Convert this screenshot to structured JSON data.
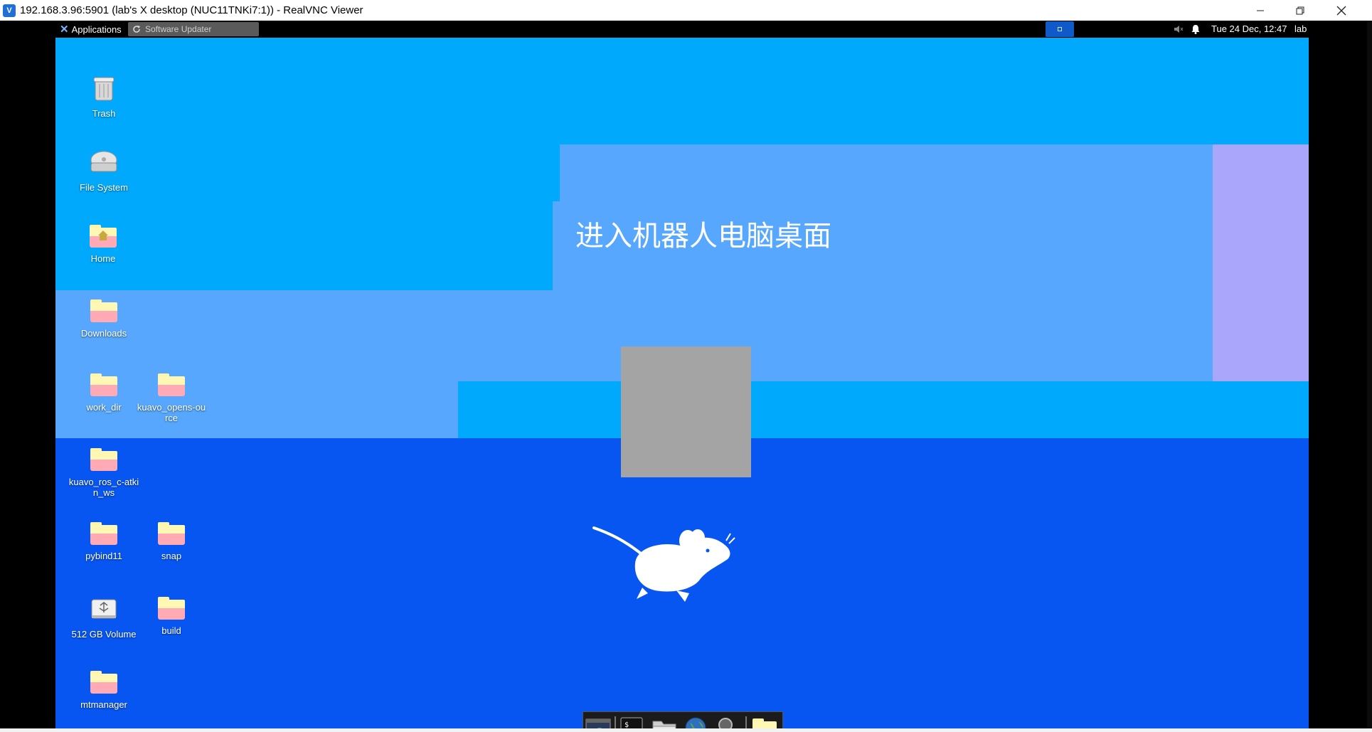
{
  "window": {
    "title": "192.168.3.96:5901 (lab's X desktop (NUC11TNKi7:1)) - RealVNC Viewer",
    "app_icon": "realvnc-logo",
    "controls": [
      "minimize-icon",
      "restore-icon",
      "close-icon"
    ]
  },
  "panel": {
    "applications_label": "Applications",
    "task_label": "Software Updater",
    "clock": "Tue 24 Dec, 12:47",
    "user": "lab",
    "icons": [
      "xfce-icon",
      "refresh-icon",
      "workspace-icon",
      "sound-muted-icon",
      "bell-icon"
    ]
  },
  "desktop": {
    "headline": "进入机器人电脑桌面",
    "colors": {
      "base": "#0856f1",
      "cyan": "#00a9fc",
      "light_blue": "#56a7fd",
      "lavender": "#aaa6fb",
      "grey_box": "#a4a4a4"
    },
    "icons": [
      {
        "label": "Trash",
        "kind": "trash"
      },
      {
        "label": "File System",
        "kind": "drive"
      },
      {
        "label": "Home",
        "kind": "home-folder"
      },
      {
        "label": "Downloads",
        "kind": "folder"
      },
      {
        "label": "work_dir",
        "kind": "folder"
      },
      {
        "label": "kuavo_opens-ource",
        "kind": "folder"
      },
      {
        "label": "kuavo_ros_c-atkin_ws",
        "kind": "folder"
      },
      {
        "label": "pybind11",
        "kind": "folder"
      },
      {
        "label": "snap",
        "kind": "folder"
      },
      {
        "label": "512 GB Volume",
        "kind": "usb-drive"
      },
      {
        "label": "build",
        "kind": "folder"
      },
      {
        "label": "mtmanager",
        "kind": "folder"
      }
    ]
  },
  "dock": {
    "items": [
      "show-desktop-icon",
      "terminal-icon",
      "file-manager-icon",
      "web-browser-icon",
      "search-icon",
      "folder-icon"
    ]
  }
}
